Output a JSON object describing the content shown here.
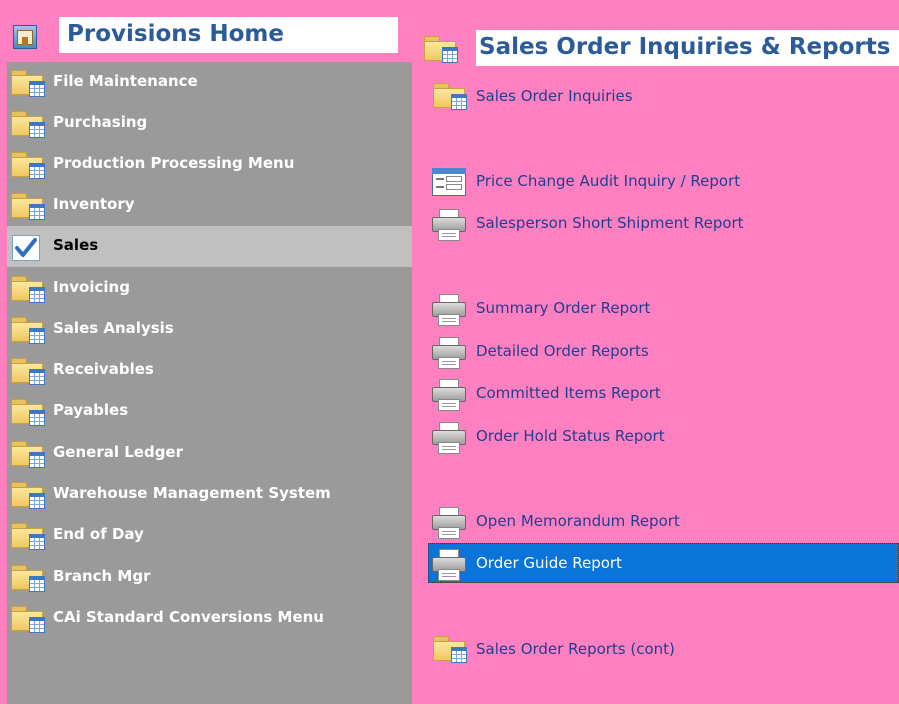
{
  "left": {
    "title": "Provisions Home",
    "items": [
      {
        "label": "File Maintenance",
        "icon": "folder-icon"
      },
      {
        "label": "Purchasing",
        "icon": "folder-icon"
      },
      {
        "label": "Production Processing Menu",
        "icon": "folder-icon"
      },
      {
        "label": "Inventory",
        "icon": "folder-icon"
      },
      {
        "label": "Sales",
        "icon": "checkmark-icon",
        "selected": true
      },
      {
        "label": "Invoicing",
        "icon": "folder-icon"
      },
      {
        "label": "Sales Analysis",
        "icon": "folder-icon"
      },
      {
        "label": "Receivables",
        "icon": "folder-icon"
      },
      {
        "label": "Payables",
        "icon": "folder-icon"
      },
      {
        "label": "General Ledger",
        "icon": "folder-icon"
      },
      {
        "label": "Warehouse Management System",
        "icon": "folder-icon"
      },
      {
        "label": "End of Day",
        "icon": "folder-icon"
      },
      {
        "label": "Branch Mgr",
        "icon": "folder-icon"
      },
      {
        "label": "CAi Standard Conversions Menu",
        "icon": "folder-icon"
      }
    ]
  },
  "right": {
    "title": "Sales Order Inquiries & Reports",
    "items": [
      {
        "label": "Sales Order Inquiries",
        "icon": "folder-icon"
      },
      {
        "label": "Price Change Audit Inquiry / Report",
        "icon": "form-window-icon"
      },
      {
        "label": "Salesperson Short Shipment Report",
        "icon": "printer-icon"
      },
      {
        "label": "Summary Order Report",
        "icon": "printer-icon"
      },
      {
        "label": "Detailed Order Reports",
        "icon": "printer-icon"
      },
      {
        "label": "Committed Items Report",
        "icon": "printer-icon"
      },
      {
        "label": "Order Hold Status Report",
        "icon": "printer-icon"
      },
      {
        "label": "Open Memorandum Report",
        "icon": "printer-icon"
      },
      {
        "label": "Order Guide Report",
        "icon": "printer-icon",
        "highlighted": true
      },
      {
        "label": "Sales Order Reports (cont)",
        "icon": "folder-icon"
      }
    ]
  },
  "colors": {
    "background": "#fe80c0",
    "nav_background": "#9a9a9a",
    "nav_selected": "#c0c0c0",
    "title_text": "#2b5b9a",
    "link_text": "#1f3f8f",
    "highlight": "#0a74d8"
  }
}
